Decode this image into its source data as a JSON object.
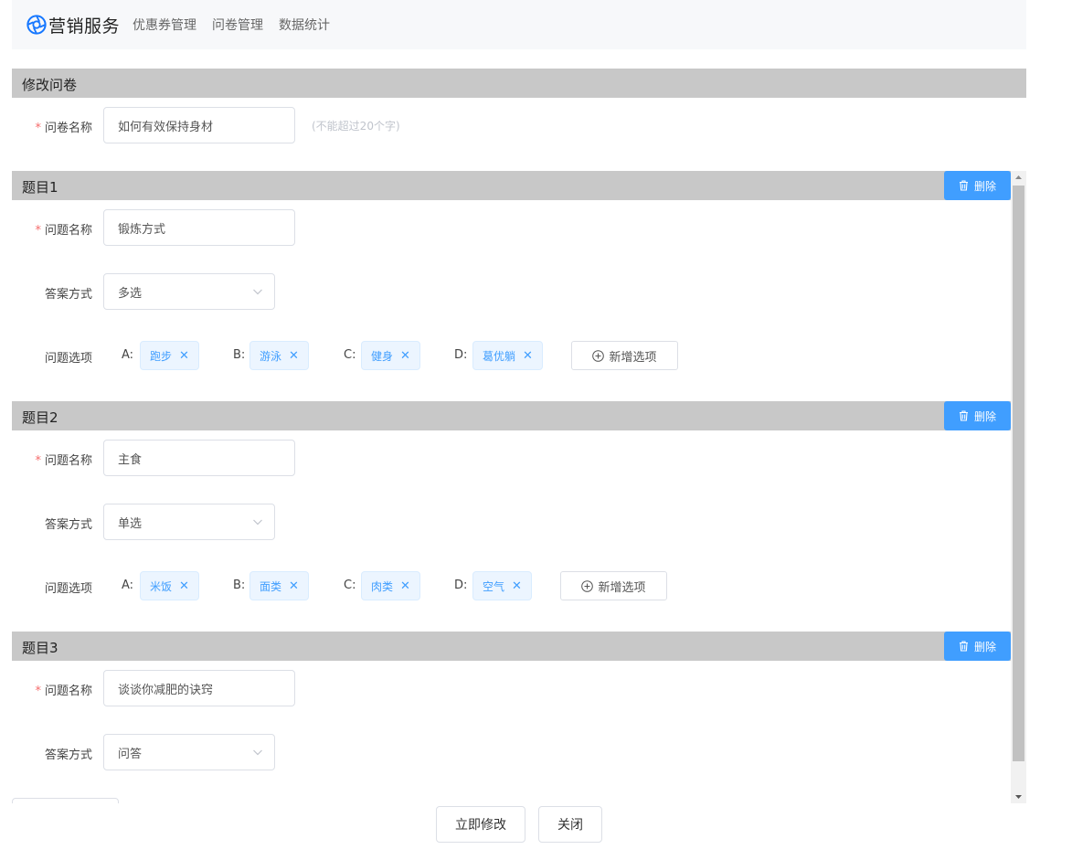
{
  "app": {
    "brand": "营销服务",
    "logo_icon": "aperture-icon",
    "accent": "#409eff"
  },
  "nav": {
    "items": [
      "优惠券管理",
      "问卷管理",
      "数据统计"
    ]
  },
  "survey": {
    "section_title": "修改问卷",
    "name_label": "问卷名称",
    "name_value": "如何有效保持身材",
    "name_hint": "(不能超过20个字)"
  },
  "questions": [
    {
      "title": "题目1",
      "delete_label": "删除",
      "name_label": "问题名称",
      "name_value": "锻炼方式",
      "answer_label": "答案方式",
      "answer_value": "多选",
      "options_label": "问题选项",
      "options": [
        {
          "letter": "A:",
          "text": "跑步"
        },
        {
          "letter": "B:",
          "text": "游泳"
        },
        {
          "letter": "C:",
          "text": "健身"
        },
        {
          "letter": "D:",
          "text": "葛优躺"
        }
      ],
      "add_option_label": "新增选项"
    },
    {
      "title": "题目2",
      "delete_label": "删除",
      "name_label": "问题名称",
      "name_value": "主食",
      "answer_label": "答案方式",
      "answer_value": "单选",
      "options_label": "问题选项",
      "options": [
        {
          "letter": "A:",
          "text": "米饭"
        },
        {
          "letter": "B:",
          "text": "面类"
        },
        {
          "letter": "C:",
          "text": "肉类"
        },
        {
          "letter": "D:",
          "text": "空气"
        }
      ],
      "add_option_label": "新增选项"
    },
    {
      "title": "题目3",
      "delete_label": "删除",
      "name_label": "问题名称",
      "name_value": "谈谈你减肥的诀窍",
      "answer_label": "答案方式",
      "answer_value": "问答"
    }
  ],
  "footer": {
    "submit_label": "立即修改",
    "close_label": "关闭"
  }
}
